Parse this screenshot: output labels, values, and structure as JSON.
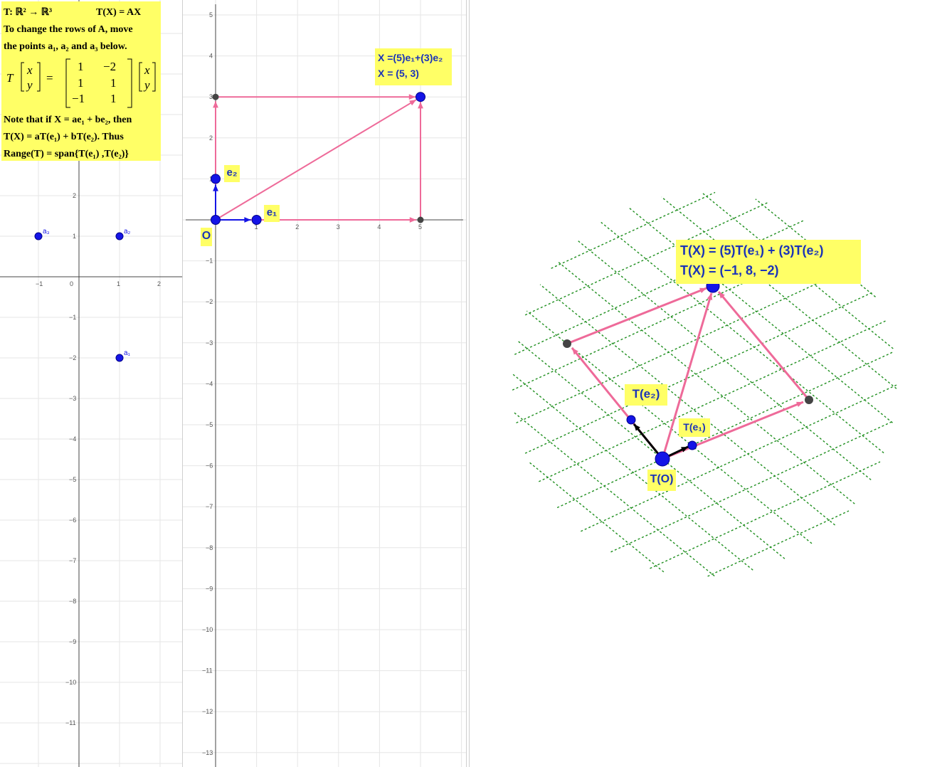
{
  "info_panel": {
    "line1_left": "T: ℝ² → ℝ³",
    "line1_right": "T(X) = AX",
    "line2": "To change the rows of  A, move",
    "line3": "the points a₁, a₂ and a₃ below.",
    "matrix_T": "T",
    "matrix_x": "x",
    "matrix_y": "y",
    "matrix_eq": "=",
    "matrix_r1c1": "1",
    "matrix_r1c2": "−2",
    "matrix_r2c1": "1",
    "matrix_r2c2": "1",
    "matrix_r3c1": "−1",
    "matrix_r3c2": "1",
    "line4": "Note that if X = ae₁ + be₂, then",
    "line5": "T(X) = aT(e₁) + bT(e₂). Thus",
    "line6": "Range(T) = span{T(e₁) ,T(e₂)}"
  },
  "view1": {
    "x_ticks": [
      "−1",
      "0",
      "1",
      "2"
    ],
    "y_ticks": [
      "2",
      "1",
      "−1",
      "−2",
      "−3",
      "−4",
      "−5",
      "−6",
      "−7",
      "−8",
      "−9",
      "−10",
      "−11"
    ],
    "points": [
      {
        "label": "a₃",
        "x": -1,
        "y": 1
      },
      {
        "label": "a₂",
        "x": 1,
        "y": 1
      },
      {
        "label": "a₁",
        "x": 1,
        "y": -2
      }
    ]
  },
  "view2": {
    "x_ticks": [
      "1",
      "2",
      "3",
      "4",
      "5"
    ],
    "y_ticks": [
      "5",
      "4",
      "3",
      "2",
      "1",
      "−1",
      "−2",
      "−3",
      "−4",
      "−5",
      "−6",
      "−7",
      "−8",
      "−9",
      "−10",
      "−11",
      "−12",
      "−13"
    ],
    "label_O": "O",
    "label_e1": "e₁",
    "label_e2": "e₂",
    "caption_line1": "X =(5)e₁+(3)e₂",
    "caption_line2": "X = (5, 3)",
    "X": [
      5,
      3
    ]
  },
  "view3": {
    "caption_line1": "T(X) = (5)T(e₁) + (3)T(e₂)",
    "caption_line2": "T(X) = (−1, 8, −2)",
    "label_Te2": "T(e₂)",
    "label_Te1": "T(e₁)",
    "label_TO": "T(O)"
  },
  "colors": {
    "accent_pink": "#ee6a99",
    "point_blue": "#1414e6",
    "label_bg": "#ffff66",
    "label_text": "#1a33b8",
    "grid_green": "#1f8f1f",
    "point_dark": "#444444"
  }
}
